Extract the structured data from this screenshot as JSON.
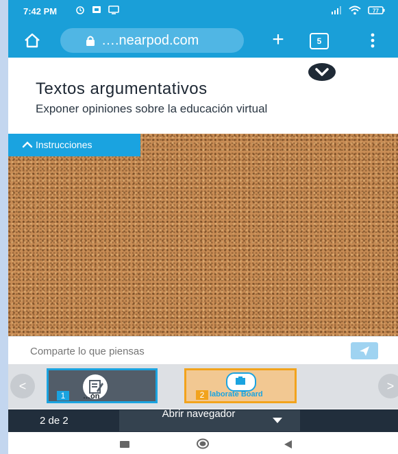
{
  "status_bar": {
    "time": "7:42 PM",
    "battery_label": "77"
  },
  "browser": {
    "url": "….nearpod.com",
    "tab_count": "5",
    "new_tab_label": "+"
  },
  "header": {
    "title": "Textos argumentativos",
    "subtitle": "Exponer opiniones sobre la educación virtual"
  },
  "board": {
    "instructions_label": "Instrucciones"
  },
  "comment": {
    "placeholder": "Comparte lo que piensas"
  },
  "slides": [
    {
      "number": "1",
      "label": "…ón"
    },
    {
      "number": "2",
      "label": "laborate Board"
    }
  ],
  "nav": {
    "prev_label": "<",
    "next_label": ">"
  },
  "footer": {
    "page_counter": "2 de 2",
    "open_navigator_label": "Abrir navegador"
  },
  "colors": {
    "accent": "#1aa3e0",
    "browser_bar": "#1a9fd8",
    "footer": "#212e3c",
    "active_slide_border": "#f2a31c"
  }
}
